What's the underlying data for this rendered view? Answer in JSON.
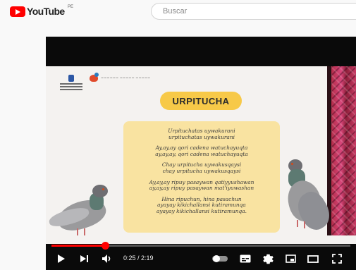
{
  "header": {
    "logo_text": "YouTube",
    "region": "PE",
    "search": {
      "placeholder": "Buscar"
    }
  },
  "video": {
    "title_card": "URPITUCHA",
    "lyrics": [
      [
        "Urpituchatas uywakurani",
        "urpituchatas uywakurani"
      ],
      [
        "Ay,ay,ay qori cadena watuchayuqta",
        "ay,ay,ay, qori cadena watuchayuqta"
      ],
      [
        "Chay urpitucha uywakusqaysi",
        "chay urpitucha uywakusqaysi"
      ],
      [
        "Ay,ay,ay ripuy pasaywan qatiyyushawan",
        "ay,ay,ay ripuy pasaywan mat'iyuwashan"
      ],
      [
        "Hina ripuchun, hina pasachun",
        "ayayay kikichallansi kutiramunqa",
        "ayayay kikichallansi kutiramunqa."
      ]
    ]
  },
  "player": {
    "current_time": "0:25",
    "duration": "2:19",
    "time_display": "0:25 / 2:19",
    "progress": 0.18,
    "colors": {
      "progress": "#ff0000",
      "title_pill": "#f7c948",
      "lyrics_box": "#f9e3a1"
    }
  },
  "icons": {
    "play": "play-icon",
    "next": "next-icon",
    "volume": "volume-icon",
    "autoplay": "autoplay-toggle-icon",
    "subtitles": "subtitles-icon",
    "settings": "gear-icon",
    "miniplayer": "miniplayer-icon",
    "theater": "theater-icon",
    "fullscreen": "fullscreen-icon"
  }
}
